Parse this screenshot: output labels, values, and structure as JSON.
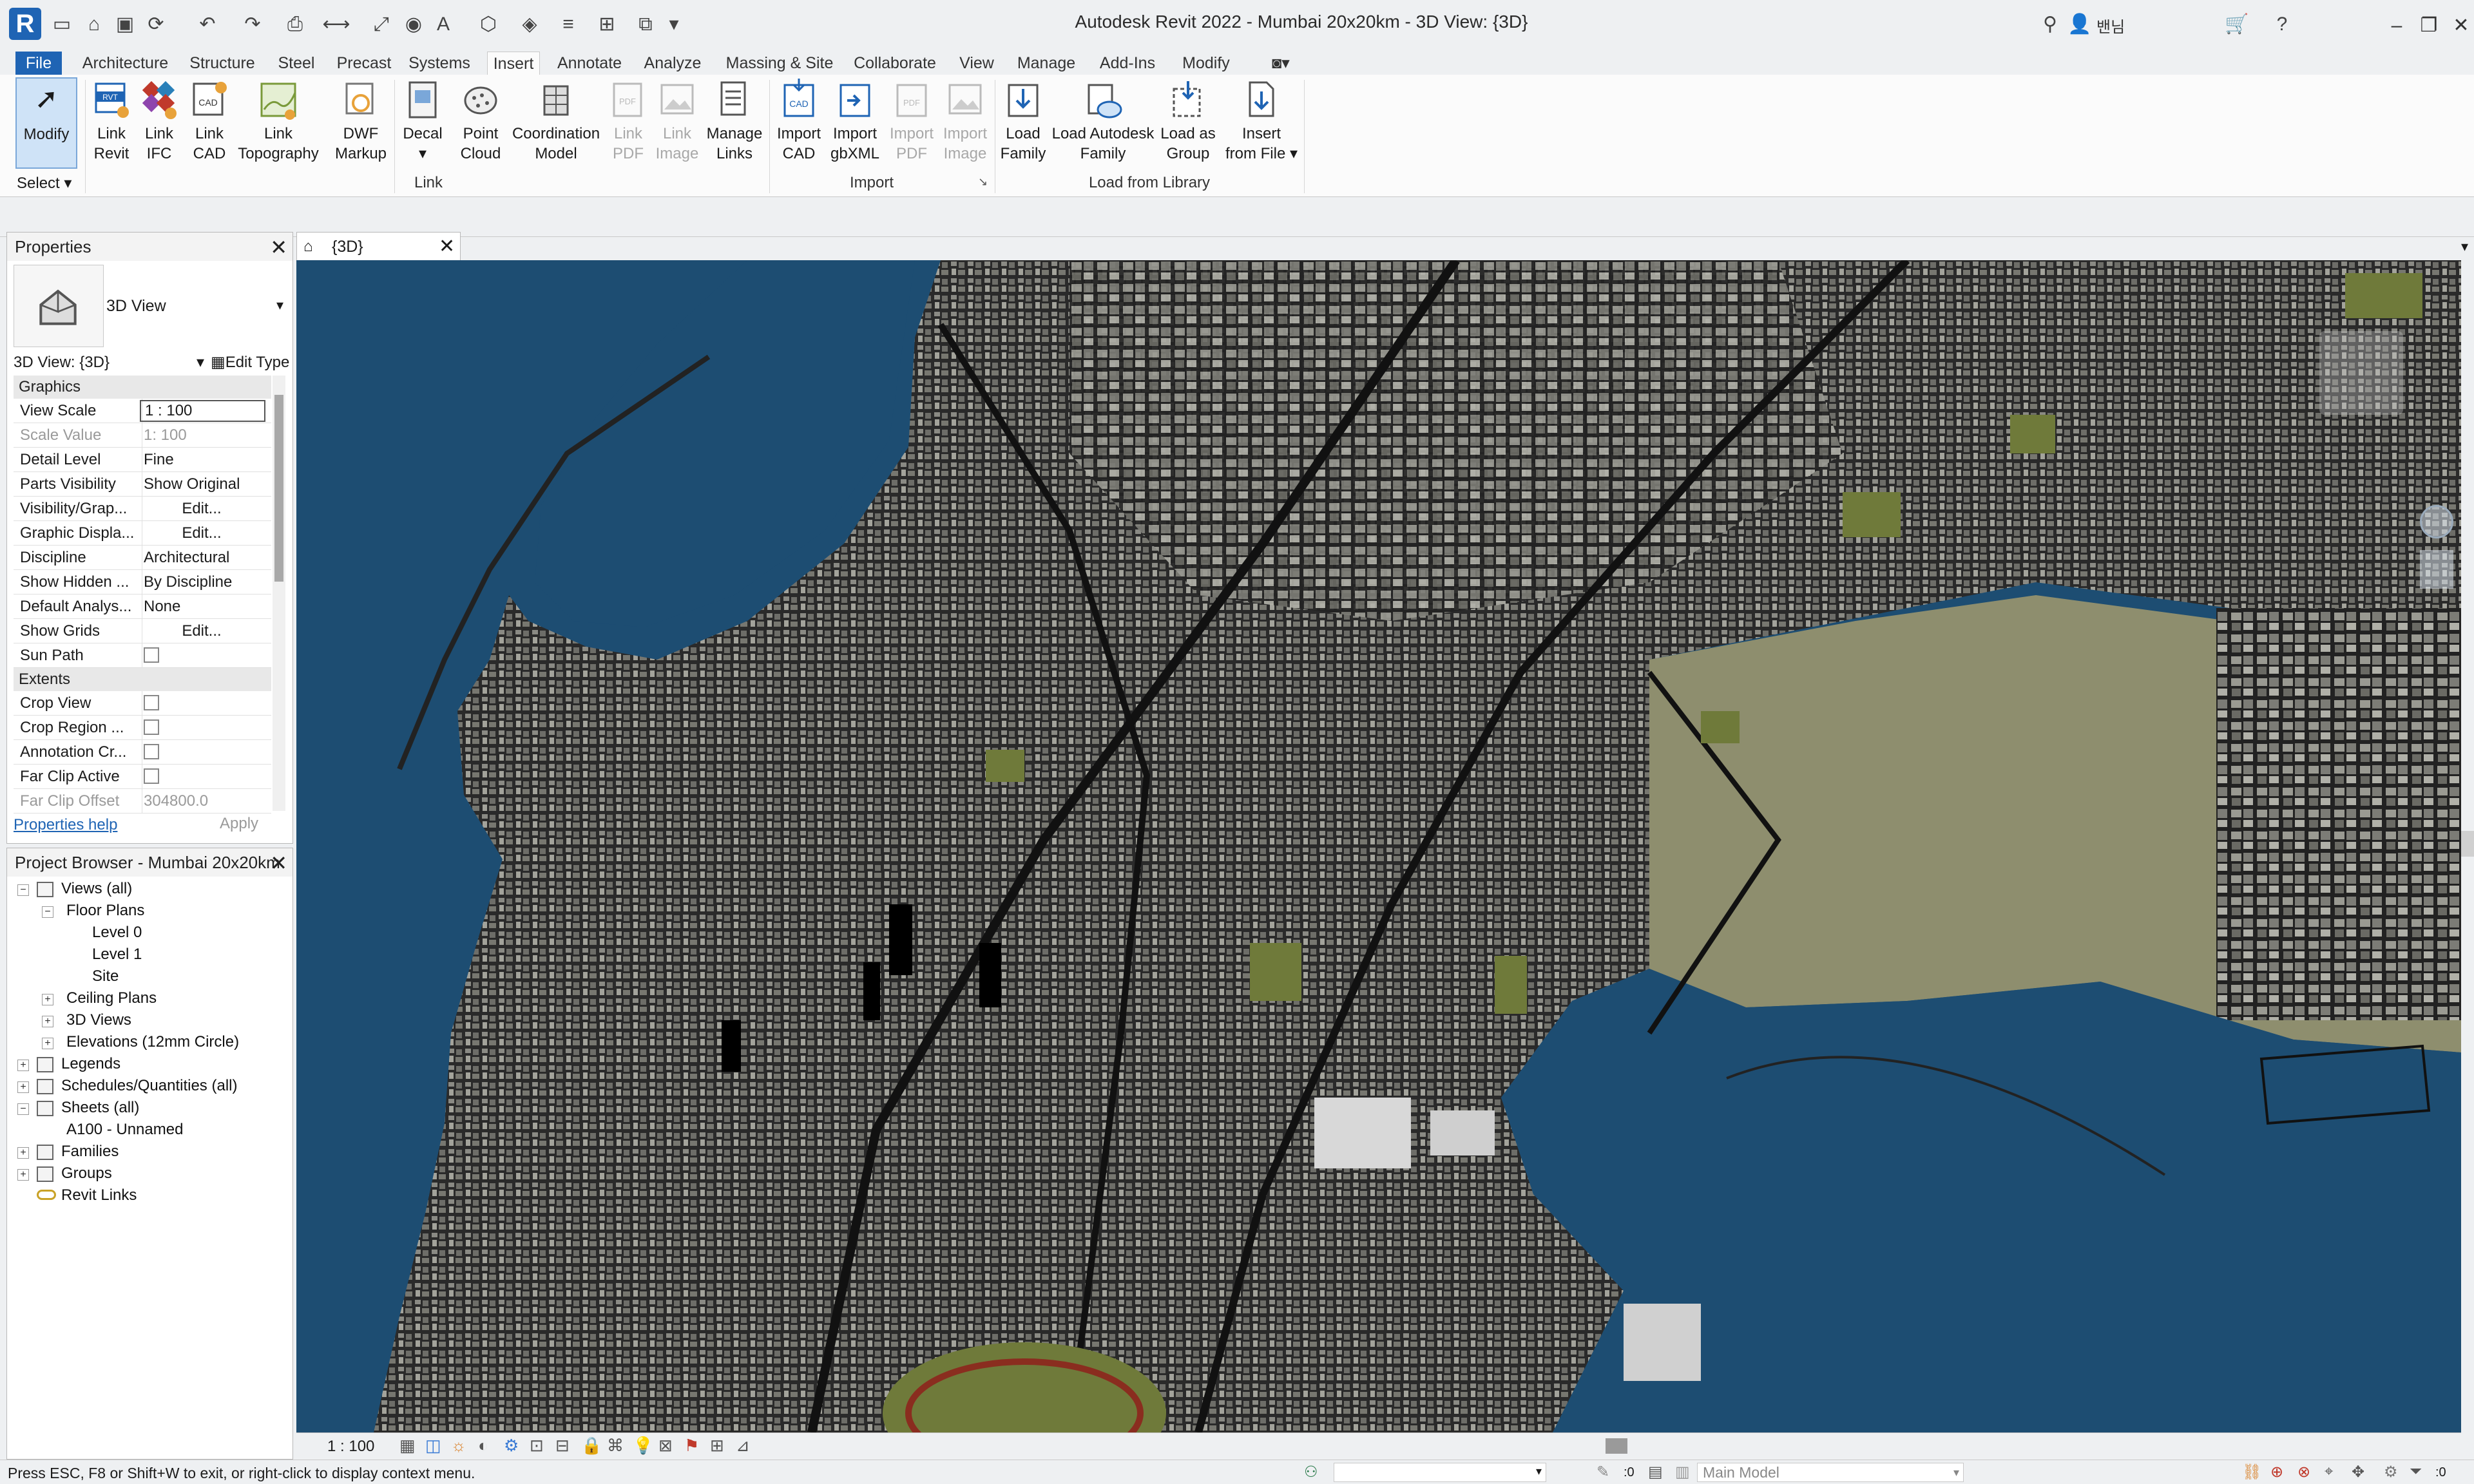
{
  "window": {
    "title": "Autodesk Revit 2022 - Mumbai 20x20km - 3D View: {3D}",
    "user": "밴님"
  },
  "tabs": [
    "File",
    "Architecture",
    "Structure",
    "Steel",
    "Precast",
    "Systems",
    "Insert",
    "Annotate",
    "Analyze",
    "Massing & Site",
    "Collaborate",
    "View",
    "Manage",
    "Add-Ins",
    "Modify"
  ],
  "active_tab": "Insert",
  "ribbon": {
    "modify": "Modify",
    "select_label": "Select",
    "buttons": {
      "link_revit": [
        "Link",
        "Revit"
      ],
      "link_ifc": [
        "Link",
        "IFC"
      ],
      "link_cad": [
        "Link",
        "CAD"
      ],
      "link_topography": [
        "Link",
        "Topography"
      ],
      "dwf_markup": [
        "DWF",
        "Markup"
      ],
      "decal": [
        "Decal",
        ""
      ],
      "point_cloud": [
        "Point",
        "Cloud"
      ],
      "coordination_model": [
        "Coordination",
        "Model"
      ],
      "link_pdf": [
        "Link",
        "PDF"
      ],
      "link_image": [
        "Link",
        "Image"
      ],
      "manage_links": [
        "Manage",
        "Links"
      ],
      "import_cad": [
        "Import",
        "CAD"
      ],
      "import_gbxml": [
        "Import",
        "gbXML"
      ],
      "import_pdf": [
        "Import",
        "PDF"
      ],
      "import_image": [
        "Import",
        "Image"
      ],
      "load_family": [
        "Load",
        "Family"
      ],
      "load_autodesk_family": [
        "Load Autodesk",
        "Family"
      ],
      "load_as_group": [
        "Load as",
        "Group"
      ],
      "insert_from_file": [
        "Insert",
        "from File"
      ]
    },
    "groups": {
      "link": "Link",
      "import": "Import",
      "load_from_library": "Load from Library"
    }
  },
  "properties": {
    "title": "Properties",
    "type_name": "3D View",
    "selector": "3D View: {3D}",
    "edit_type": "Edit Type",
    "group_graphics": "Graphics",
    "group_extents": "Extents",
    "rows": [
      {
        "name": "View Scale",
        "value": "1 : 100"
      },
      {
        "name": "Scale Value",
        "value": "1: 100"
      },
      {
        "name": "Detail Level",
        "value": "Fine"
      },
      {
        "name": "Parts Visibility",
        "value": "Show Original"
      },
      {
        "name": "Visibility/Grap...",
        "value": "Edit..."
      },
      {
        "name": "Graphic Displa...",
        "value": "Edit..."
      },
      {
        "name": "Discipline",
        "value": "Architectural"
      },
      {
        "name": "Show Hidden ...",
        "value": "By Discipline"
      },
      {
        "name": "Default Analys...",
        "value": "None"
      },
      {
        "name": "Show Grids",
        "value": "Edit..."
      },
      {
        "name": "Sun Path",
        "value": ""
      }
    ],
    "extents_rows": [
      {
        "name": "Crop View",
        "value": ""
      },
      {
        "name": "Crop Region ...",
        "value": ""
      },
      {
        "name": "Annotation Cr...",
        "value": ""
      },
      {
        "name": "Far Clip Active",
        "value": ""
      },
      {
        "name": "Far Clip Offset",
        "value": "304800.0"
      }
    ],
    "help_link": "Properties help",
    "apply": "Apply"
  },
  "browser": {
    "title": "Project Browser - Mumbai 20x20km",
    "items": [
      "Views (all)",
      "Floor Plans",
      "Level 0",
      "Level 1",
      "Site",
      "Ceiling Plans",
      "3D Views",
      "Elevations (12mm Circle)",
      "Legends",
      "Schedules/Quantities (all)",
      "Sheets (all)",
      "A100 - Unnamed",
      "Families",
      "Groups",
      "Revit Links"
    ]
  },
  "view": {
    "tab_label": "{3D}",
    "scale": "1 : 100"
  },
  "status": {
    "message": "Press ESC, F8 or Shift+W to exit, or right-click to display context menu.",
    "zero": ":0",
    "model": "Main Model",
    "filter_count": ":0"
  },
  "colors": {
    "water": "#1d4d72",
    "land": "#7b7c6a",
    "city": "#2b2b2b",
    "accent": "#1f64b4"
  }
}
